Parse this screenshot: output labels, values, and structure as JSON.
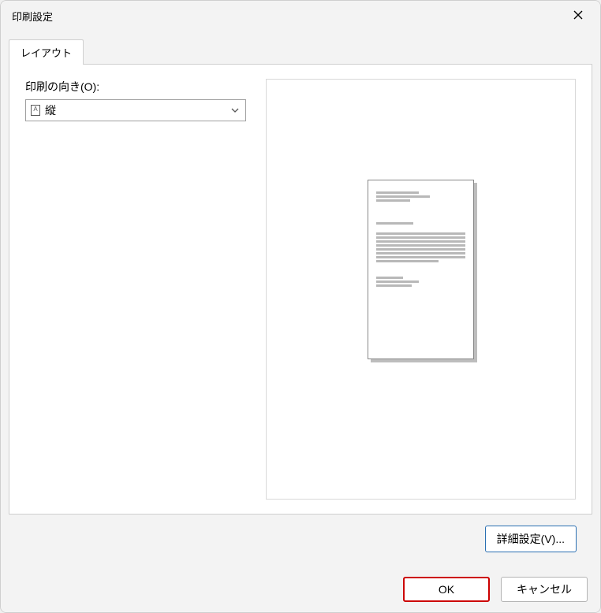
{
  "dialog": {
    "title": "印刷設定",
    "close_icon": "close"
  },
  "tabs": {
    "layout": {
      "label": "レイアウト"
    }
  },
  "orientation": {
    "label": "印刷の向き(O):",
    "selected": "縦",
    "icon_glyph": "A"
  },
  "buttons": {
    "advanced": "詳細設定(V)...",
    "ok": "OK",
    "cancel": "キャンセル"
  }
}
